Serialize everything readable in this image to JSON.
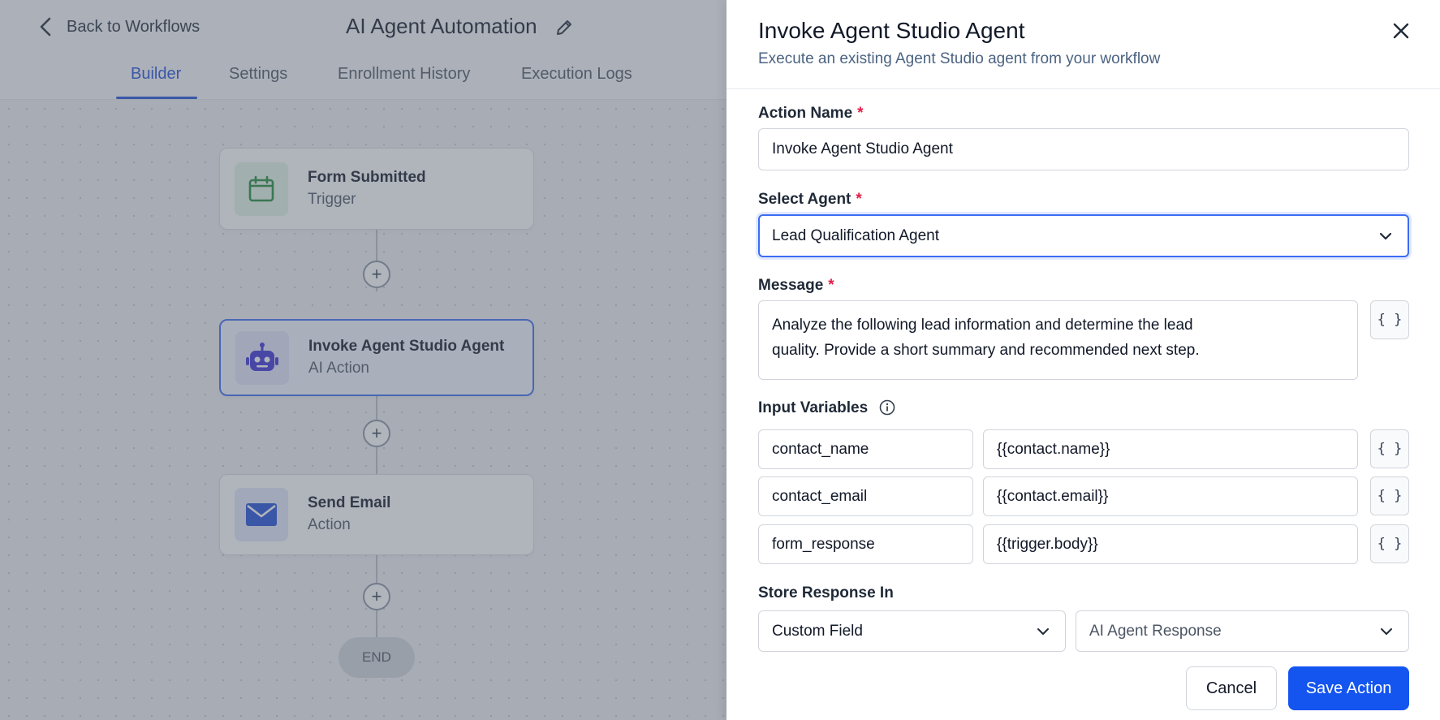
{
  "header": {
    "back_label": "Back to Workflows",
    "workflow_title": "AI Agent Automation"
  },
  "tabs": [
    {
      "label": "Builder",
      "active": true
    },
    {
      "label": "Settings",
      "active": false
    },
    {
      "label": "Enrollment History",
      "active": false
    },
    {
      "label": "Execution Logs",
      "active": false
    }
  ],
  "workflow": {
    "nodes": [
      {
        "title": "Form Submitted",
        "subtitle": "Trigger",
        "icon": "calendar-icon",
        "color": "#1f8a3b"
      },
      {
        "title": "Invoke Agent Studio Agent",
        "subtitle": "AI Action",
        "icon": "robot-icon",
        "color": "#3b2fd6"
      },
      {
        "title": "Send Email",
        "subtitle": "Action",
        "icon": "envelope-icon",
        "color": "#1d4ed8"
      }
    ],
    "end_label": "END"
  },
  "drawer": {
    "title": "Invoke Agent Studio Agent",
    "subtitle": "Execute an existing Agent Studio agent from your workflow",
    "action_name": {
      "label": "Action Name",
      "value": "Invoke Agent Studio Agent"
    },
    "select_agent": {
      "label": "Select Agent",
      "value": "Lead Qualification Agent"
    },
    "message": {
      "label": "Message",
      "line1": "Analyze the following lead information and determine the lead",
      "line2": "quality. Provide a short summary and recommended next step."
    },
    "input_variables": {
      "label": "Input Variables",
      "rows": [
        {
          "key": "contact_name",
          "value": "{{contact.name}}"
        },
        {
          "key": "contact_email",
          "value": "{{contact.email}}"
        },
        {
          "key": "form_response",
          "value": "{{trigger.body}}"
        }
      ]
    },
    "var_button_label": "{ }",
    "store_response": {
      "label": "Store Response In",
      "type": "Custom Field",
      "field": "AI Agent Response"
    },
    "cancel_label": "Cancel",
    "save_label": "Save Action"
  },
  "colors": {
    "accent": "#1455f0",
    "required": "#e11d48"
  }
}
